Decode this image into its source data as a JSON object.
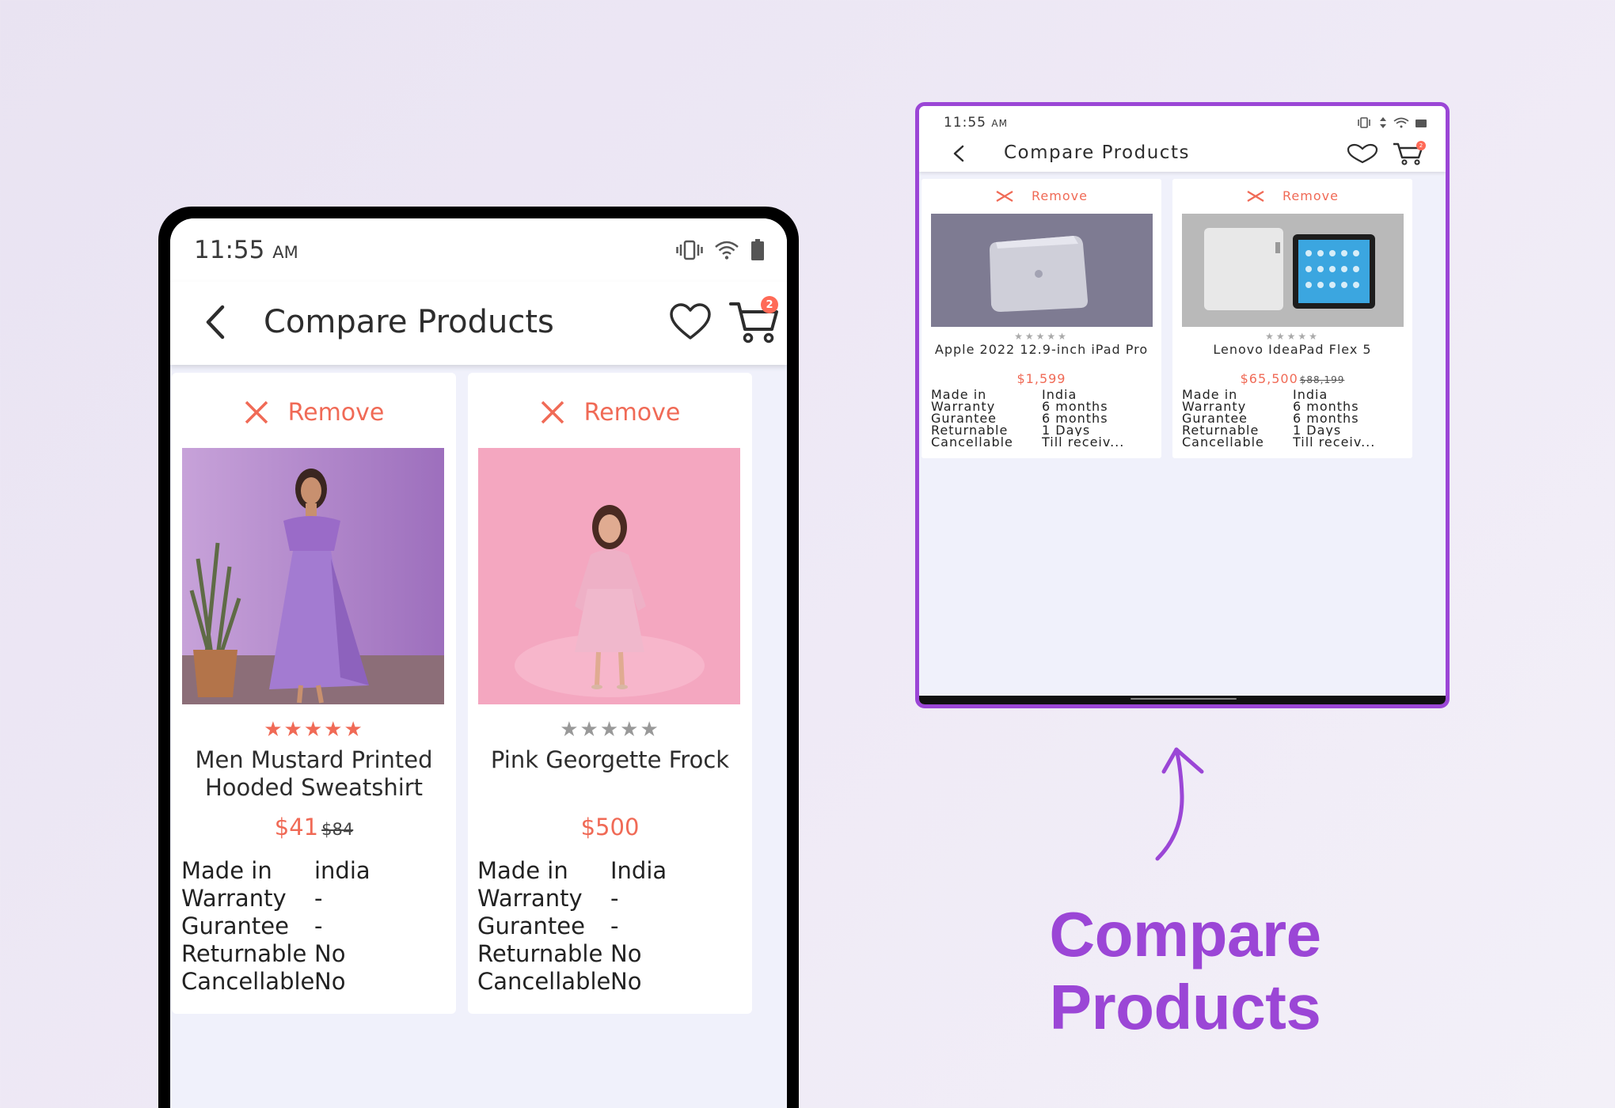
{
  "colors": {
    "accent": "#9b46d6",
    "remove": "#f06a56",
    "price": "#f06a56",
    "star_filled": "#f06a56",
    "star_empty": "#999999",
    "screen_bg": "#f0f1fb"
  },
  "headline": "Compare Products",
  "phone_large": {
    "status": {
      "time": "11:55",
      "ampm": "AM"
    },
    "header": {
      "title": "Compare Products",
      "cart_badge": "2"
    },
    "products": [
      {
        "remove_label": "Remove",
        "rating": 5,
        "name": "Men Mustard Printed Hooded Sweatshirt",
        "price": "$41",
        "old_price": "$84",
        "specs": [
          {
            "key": "Made in",
            "value": "india"
          },
          {
            "key": "Warranty",
            "value": "-"
          },
          {
            "key": "Gurantee",
            "value": "-"
          },
          {
            "key": "Returnable",
            "value": "No"
          },
          {
            "key": "Cancellable",
            "value": "No"
          }
        ]
      },
      {
        "remove_label": "Remove",
        "rating": 0,
        "name": "Pink Georgette Frock",
        "price": "$500",
        "old_price": "",
        "specs": [
          {
            "key": "Made in",
            "value": "India"
          },
          {
            "key": "Warranty",
            "value": "-"
          },
          {
            "key": "Gurantee",
            "value": "-"
          },
          {
            "key": "Returnable",
            "value": "No"
          },
          {
            "key": "Cancellable",
            "value": "No"
          }
        ]
      }
    ]
  },
  "phone_small": {
    "status": {
      "time": "11:55",
      "ampm": "AM"
    },
    "header": {
      "title": "Compare Products",
      "cart_badge": "2"
    },
    "products": [
      {
        "remove_label": "Remove",
        "rating": 0,
        "name": "Apple 2022 12.9-inch iPad Pro",
        "price": "$1,599",
        "old_price": "",
        "specs": [
          {
            "key": "Made in",
            "value": "India"
          },
          {
            "key": "Warranty",
            "value": "6 months"
          },
          {
            "key": "Gurantee",
            "value": "6 months"
          },
          {
            "key": "Returnable",
            "value": "1 Days"
          },
          {
            "key": "Cancellable",
            "value": "Till receiv..."
          }
        ]
      },
      {
        "remove_label": "Remove",
        "rating": 0,
        "name": "Lenovo IdeaPad Flex 5",
        "price": "$65,500",
        "old_price": "$88,199",
        "specs": [
          {
            "key": "Made in",
            "value": "India"
          },
          {
            "key": "Warranty",
            "value": "6 months"
          },
          {
            "key": "Gurantee",
            "value": "6 months"
          },
          {
            "key": "Returnable",
            "value": "1 Days"
          },
          {
            "key": "Cancellable",
            "value": "Till receiv..."
          }
        ]
      }
    ]
  }
}
